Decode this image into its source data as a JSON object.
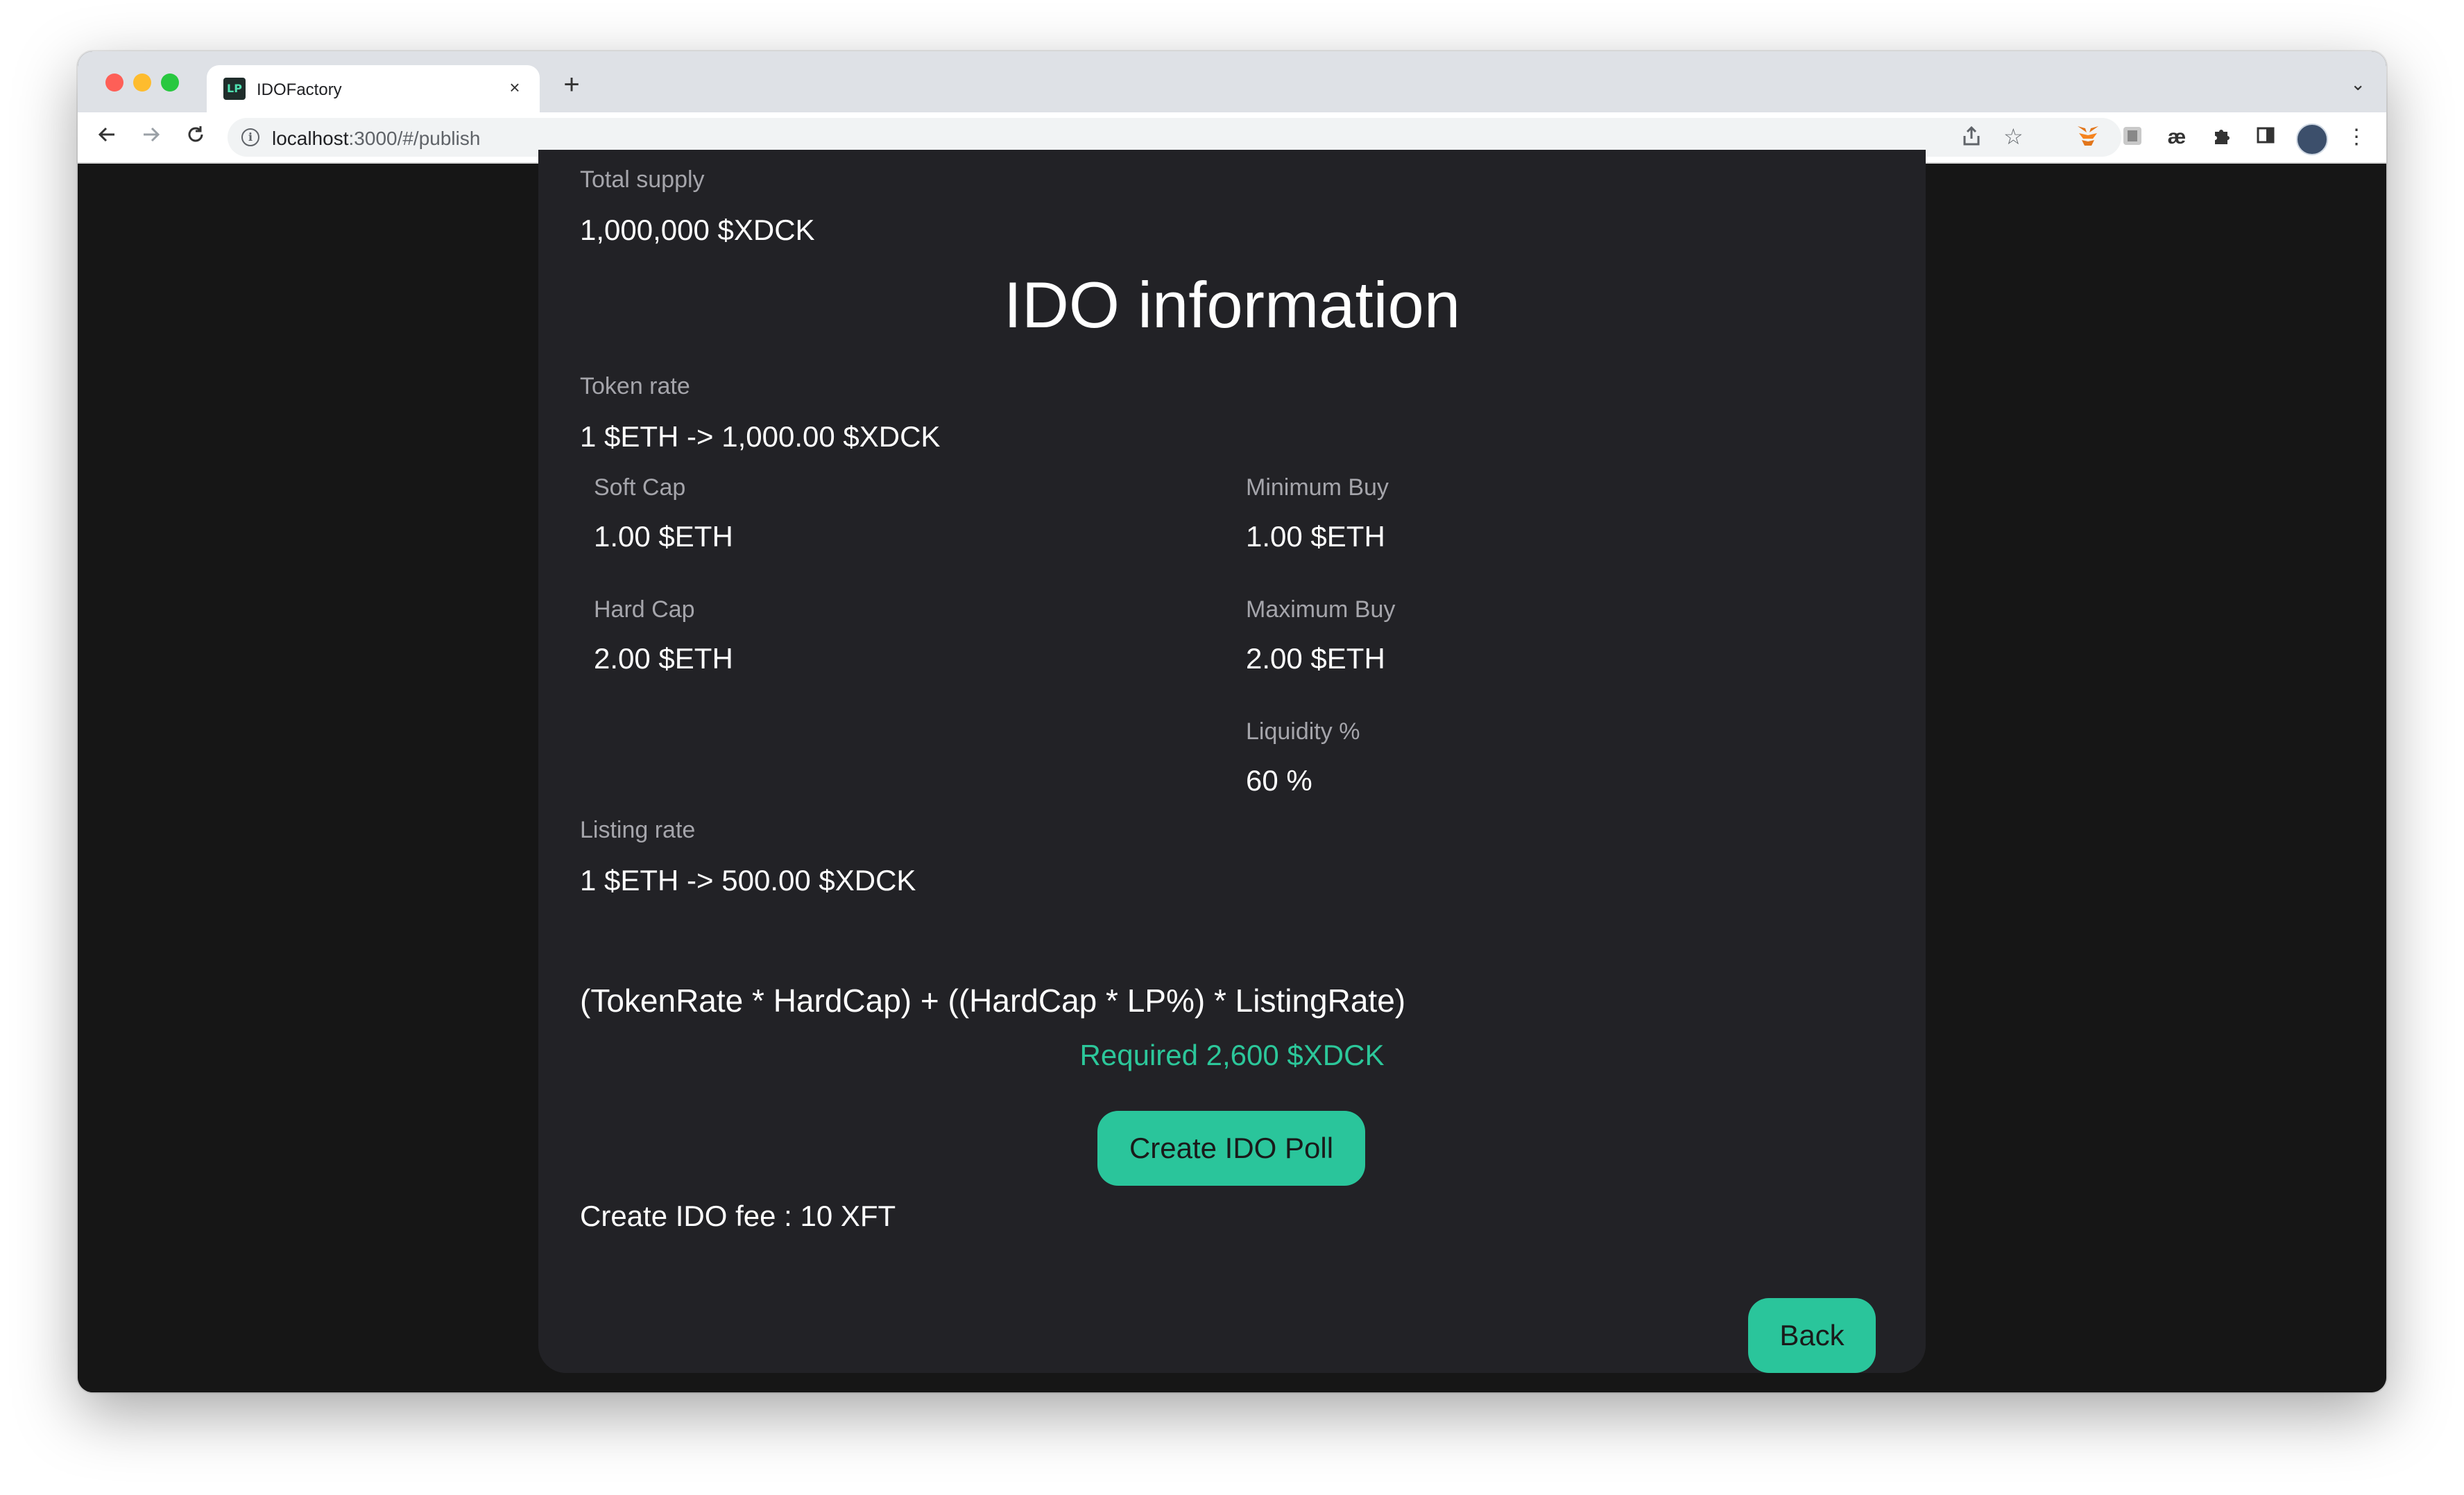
{
  "browser": {
    "tab_title": "IDOFactory",
    "tab_favicon_text": "LP",
    "tab_close": "×",
    "new_tab": "+",
    "tab_menu": "⌄",
    "url_host": "localhost",
    "url_path": ":3000/#/publish",
    "ext_ae": "æ"
  },
  "token": {
    "total_supply_label": "Total supply",
    "total_supply_value": "1,000,000 $XDCK"
  },
  "ido": {
    "heading": "IDO information",
    "token_rate_label": "Token rate",
    "token_rate_value": "1 $ETH -> 1,000.00 $XDCK",
    "soft_cap_label": "Soft Cap",
    "soft_cap_value": "1.00 $ETH",
    "hard_cap_label": "Hard Cap",
    "hard_cap_value": "2.00 $ETH",
    "min_buy_label": "Minimum Buy",
    "min_buy_value": "1.00 $ETH",
    "max_buy_label": "Maximum Buy",
    "max_buy_value": "2.00 $ETH",
    "liquidity_label": "Liquidity %",
    "liquidity_value": "60 %",
    "listing_rate_label": "Listing rate",
    "listing_rate_value": "1 $ETH -> 500.00 $XDCK",
    "formula": "(TokenRate * HardCap) + ((HardCap * LP%) * ListingRate)",
    "required": "Required 2,600 $XDCK",
    "create_button": "Create IDO Poll",
    "fee": "Create IDO fee : 10 XFT",
    "back_button": "Back"
  },
  "colors": {
    "accent": "#2ac59b",
    "card_bg": "#222226",
    "page_bg": "#161616"
  }
}
